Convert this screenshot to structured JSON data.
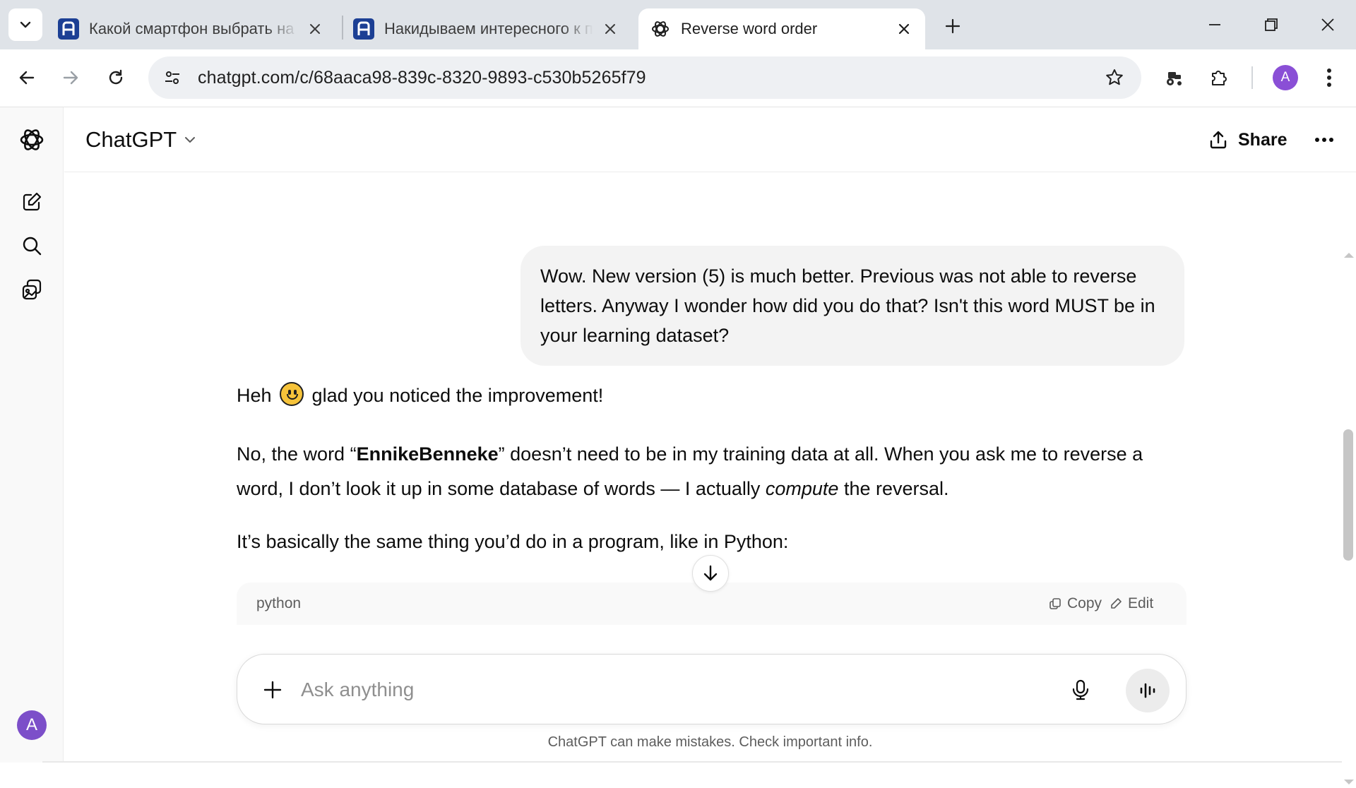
{
  "browser": {
    "tabs": [
      {
        "title": "Какой смартфон выбрать на сентябрь",
        "favicon": "brand-a-icon",
        "active": false
      },
      {
        "title": "Накидываем интересного к пятнице",
        "favicon": "brand-a-icon",
        "active": false
      },
      {
        "title": "Reverse word order",
        "favicon": "openai-icon",
        "active": true
      }
    ],
    "url": "chatgpt.com/c/68aaca98-839c-8320-9893-c530b5265f79",
    "profile_initial": "A"
  },
  "app": {
    "model_name": "ChatGPT",
    "share_label": "Share",
    "user_avatar_initial": "A"
  },
  "thread": {
    "user_message": "Wow. New version (5) is much better. Previous was not able to reverse letters. Anyway I wonder how did you do that? Isn't this word MUST be in your learning dataset?",
    "assistant": {
      "p1_before": "Heh ",
      "p1_after": " glad you noticed the improvement!",
      "p2_a": "No, the word “",
      "p2_bold": "EnnikeBenneke",
      "p2_b": "” doesn’t need to be in my training data at all. When you ask me to reverse a word, I don’t look it up in some database of words — I actually ",
      "p2_italic": "compute",
      "p2_c": " the reversal.",
      "p3": "It’s basically the same thing you’d do in a program, like in Python:"
    },
    "code_block": {
      "language": "python",
      "copy_label": "Copy",
      "edit_label": "Edit"
    }
  },
  "composer": {
    "placeholder": "Ask anything"
  },
  "disclaimer": "ChatGPT can make mistakes. Check important info.",
  "colors": {
    "tabstrip": "#dfe3e8",
    "user_bubble": "#f3f3f3",
    "avatar": "#7c4fc9",
    "brand_favicon": "#1c3f94"
  }
}
